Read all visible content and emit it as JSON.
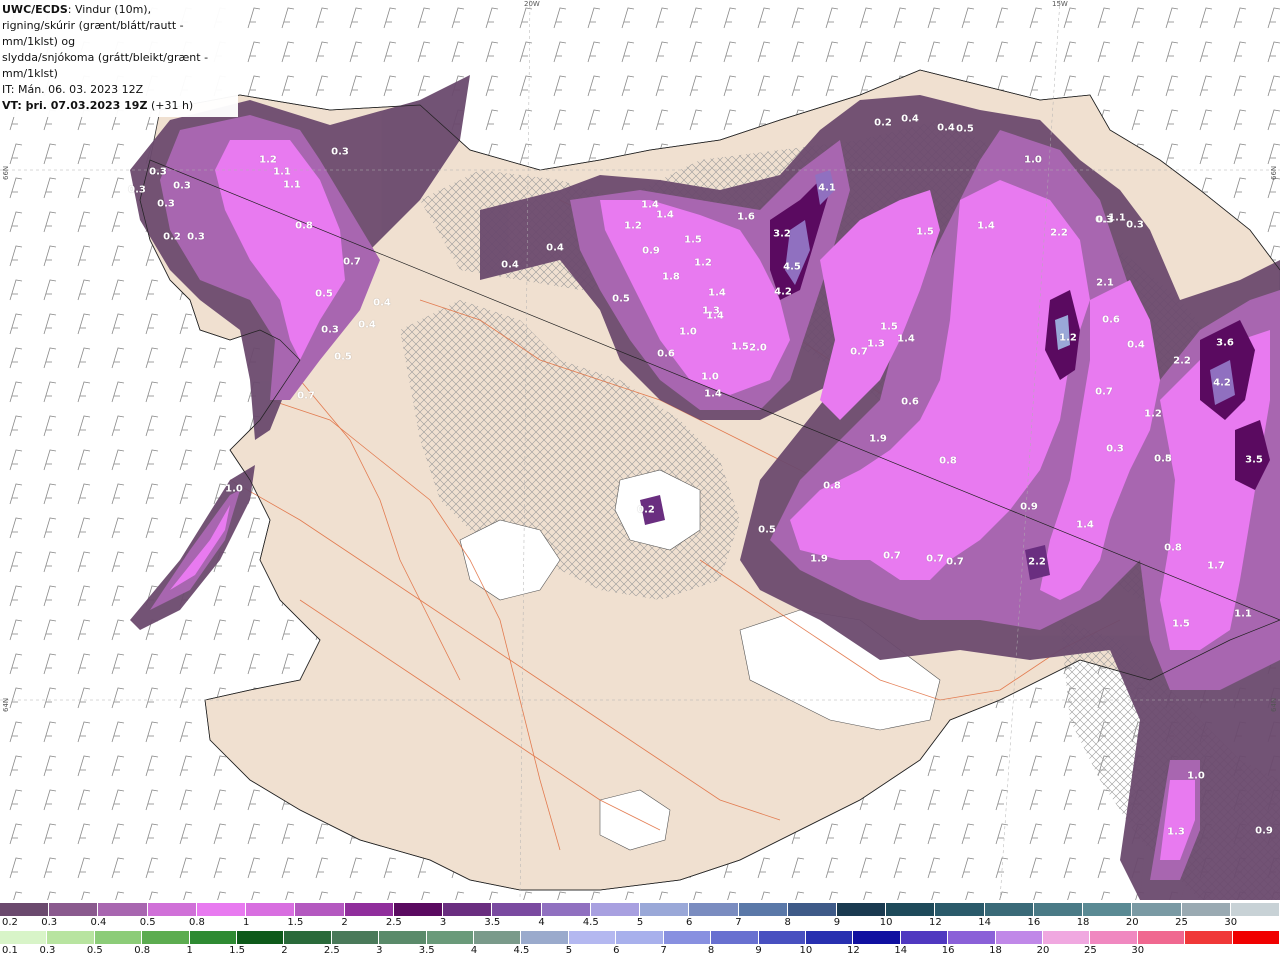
{
  "header": {
    "title": "UWC/ECDS",
    "line1": ": Vindur (10m),",
    "line2": "rigning/skúrir (grænt/blátt/rautt - mm/1klst) og",
    "line3": "slydda/snjókoma (grátt/bleikt/grænt - mm/1klst)",
    "it_line": "IT: Mán. 06. 03. 2023 12Z",
    "vt_line": "VT: þri. 07.03.2023 19Z",
    "lead": "(+31 h)"
  },
  "grid_labels": {
    "top_20w": "20W",
    "top_15w": "15W",
    "left_lat_upper": "66N",
    "left_lat_lower": "64N",
    "right_lat_upper": "66N",
    "right_lat_lower": "64N"
  },
  "value_labels": [
    "0.3",
    "1.2",
    "1.1",
    "1.1",
    "0.3",
    "0.3",
    "0.3",
    "0.3",
    "0.3",
    "0.2",
    "0.3",
    "0.8",
    "0.7",
    "0.5",
    "0.4",
    "0.3",
    "0.4",
    "0.5",
    "0.7",
    "1.0",
    "0.4",
    "0.4",
    "1.0",
    "1.1",
    "1.4",
    "1.4",
    "1.2",
    "0.9",
    "1.6",
    "4.1",
    "3.2",
    "4.5",
    "4.2",
    "1.5",
    "1.2",
    "1.8",
    "0.5",
    "1.3",
    "1.4",
    "1.4",
    "1.0",
    "0.6",
    "1.5",
    "2.0",
    "1.0",
    "1.4",
    "0.2",
    "0.4",
    "0.4",
    "0.3",
    "0.5",
    "1.0",
    "1.5",
    "1.4",
    "2.2",
    "0.3",
    "0.3",
    "2.1",
    "0.6",
    "1.2",
    "0.4",
    "1.5",
    "1.3",
    "1.4",
    "0.7",
    "0.6",
    "1.9",
    "0.7",
    "0.8",
    "2.2",
    "3.6",
    "4.2",
    "1.2",
    "0.8",
    "0.3",
    "0.5",
    "3.5",
    "0.8",
    "0.9",
    "1.4",
    "0.5",
    "1.9",
    "0.7",
    "0.7",
    "0.7",
    "2.2",
    "0.8",
    "1.7",
    "1.5",
    "1.1",
    "1.0",
    "1.3",
    "0.9",
    "0.2"
  ],
  "legend_snow": {
    "colors": [
      "#6b4a6e",
      "#8a5a8e",
      "#a866b0",
      "#d070d8",
      "#e87af0",
      "#d86ee0",
      "#b458c0",
      "#902e9c",
      "#5a0a60",
      "#6a2e80",
      "#7a4aa0",
      "#9070c0",
      "#a8a0e0",
      "#9aa8d8",
      "#7a8cc0",
      "#5a78a8",
      "#3e5a88",
      "#1a3a50",
      "#1e4a5a",
      "#2a5a6a",
      "#3a6a78",
      "#4a7a86",
      "#5a8a94",
      "#7a9aa4",
      "#9aaab2",
      "#c8d2d6"
    ],
    "ticks": [
      "0.2",
      "0.3",
      "0.4",
      "0.5",
      "0.8",
      "1",
      "1.5",
      "2",
      "2.5",
      "3",
      "3.5",
      "4",
      "4.5",
      "5",
      "6",
      "7",
      "8",
      "9",
      "10",
      "12",
      "14",
      "16",
      "18",
      "20",
      "25",
      "30"
    ]
  },
  "legend_rain": {
    "colors": [
      "#d8f4c8",
      "#b8e4a0",
      "#8ccc78",
      "#5cac50",
      "#2e8a32",
      "#0e5a1a",
      "#2a6a3a",
      "#4a7a5a",
      "#5a8a6a",
      "#6a9a7a",
      "#7a9a8a",
      "#9aaacc",
      "#b4b8f0",
      "#a8b0ec",
      "#8890e0",
      "#6870d0",
      "#4850c0",
      "#2830b0",
      "#1010a0",
      "#5038c0",
      "#8a60d8",
      "#c088e8",
      "#f0a8e0",
      "#f088c0",
      "#f06890",
      "#f03838",
      "#f00000"
    ],
    "ticks": [
      "0.1",
      "0.3",
      "0.5",
      "0.8",
      "1",
      "1.5",
      "2",
      "2.5",
      "3",
      "3.5",
      "4",
      "4.5",
      "5",
      "6",
      "7",
      "8",
      "9",
      "10",
      "12",
      "14",
      "16",
      "18",
      "20",
      "25",
      "30"
    ]
  }
}
